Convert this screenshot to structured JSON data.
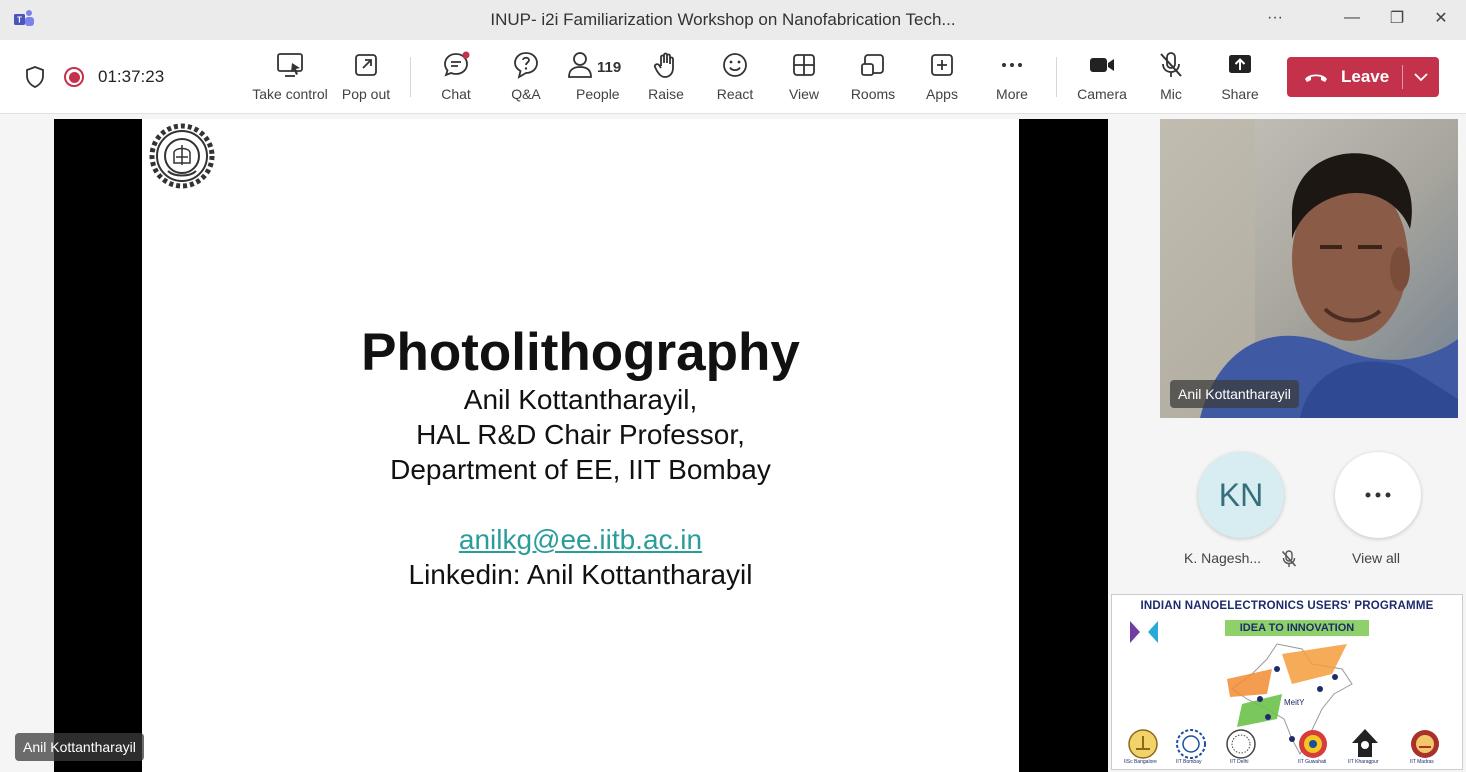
{
  "window": {
    "title": "INUP- i2i Familiarization Workshop on Nanofabrication Tech...",
    "more_glyph": "···",
    "minimize_glyph": "—",
    "restore_glyph": "❐",
    "close_glyph": "✕"
  },
  "meeting": {
    "timer": "01:37:23",
    "people_count": "119"
  },
  "toolbar": {
    "take_control": "Take control",
    "pop_out": "Pop out",
    "chat": "Chat",
    "qa": "Q&A",
    "people": "People",
    "raise": "Raise",
    "react": "React",
    "view": "View",
    "rooms": "Rooms",
    "apps": "Apps",
    "more": "More",
    "camera": "Camera",
    "mic": "Mic",
    "share": "Share",
    "leave": "Leave"
  },
  "slide": {
    "title": "Photolithography",
    "line1": "Anil Kottantharayil,",
    "line2": "HAL R&D Chair Professor,",
    "line3": "Department of EE, IIT Bombay",
    "email": "anilkg@ee.iitb.ac.in",
    "linkedin": "Linkedin: Anil Kottantharayil"
  },
  "presenter_tag": "Anil Kottantharayil",
  "participants": {
    "video_name": "Anil Kottantharayil",
    "kn_initials": "KN",
    "kn_name": "K. Nagesh...",
    "view_all": "View all"
  },
  "inup_banner": {
    "title": "INDIAN NANOELECTRONICS USERS' PROGRAMME",
    "tagline": "IDEA TO INNOVATION",
    "center": "MeitY",
    "institutes": [
      "IISc Bangalore",
      "IIT Bombay",
      "IIT Delhi",
      "IIT Guwahati",
      "IIT Kharagpur",
      "IIT Madras"
    ]
  },
  "colors": {
    "leave_red": "#c4314b",
    "record_red": "#c4314b",
    "email_teal": "#2a9d9a",
    "tagline_green": "#8ed06a"
  }
}
